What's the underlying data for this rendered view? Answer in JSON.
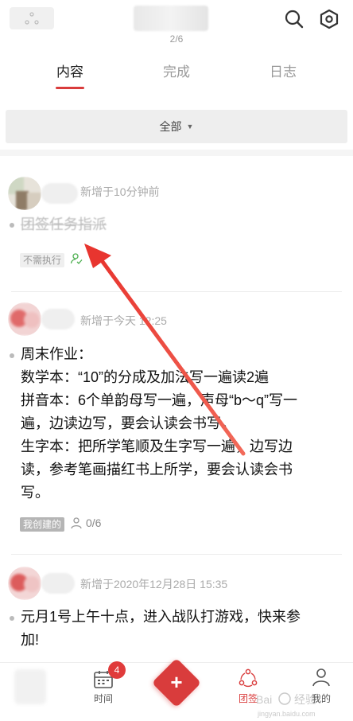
{
  "header": {
    "page_indicator": "2/6",
    "search_icon": "search-icon",
    "settings_icon": "hexagon-gear-icon"
  },
  "tabs": [
    {
      "label": "内容",
      "active": true
    },
    {
      "label": "完成",
      "active": false
    },
    {
      "label": "日志",
      "active": false
    }
  ],
  "filter": {
    "label": "全部",
    "icon": "caret-down-icon"
  },
  "feed": [
    {
      "meta": "新增于10分钟前",
      "text": "团签任务指派",
      "completed": true,
      "tag": "不需执行",
      "assignee_icon": "user-check-icon"
    },
    {
      "meta": "新增于今天 12:25",
      "lines": [
        "周末作业：",
        "数学本：“10”的分成及加法写一遍读2遍",
        "拼音本：6个单韵母写一遍，声母“b～q”写一",
        "遍，边读边写，要会认读会书写。",
        "生字本：把所学笔顺及生字写一遍，边写边",
        "读，参考笔画描红书上所学，要会认读会书",
        "写。"
      ],
      "tag": "我创建的",
      "assignee_icon": "user-icon",
      "progress": "0/6"
    },
    {
      "meta": "新增于2020年12月28日 15:35",
      "lines": [
        "元月1号上午十点，进入战队打游戏，快来参",
        "加!"
      ]
    }
  ],
  "bottom_nav": {
    "time_label": "时间",
    "time_badge": "4",
    "add_label": "+",
    "team_sign_label": "团签",
    "mine_label": "我的"
  },
  "colors": {
    "accent": "#d93c3c",
    "muted_text": "#999999",
    "arrow": "#e8352f"
  },
  "watermark": "jingyan.baidu.com"
}
